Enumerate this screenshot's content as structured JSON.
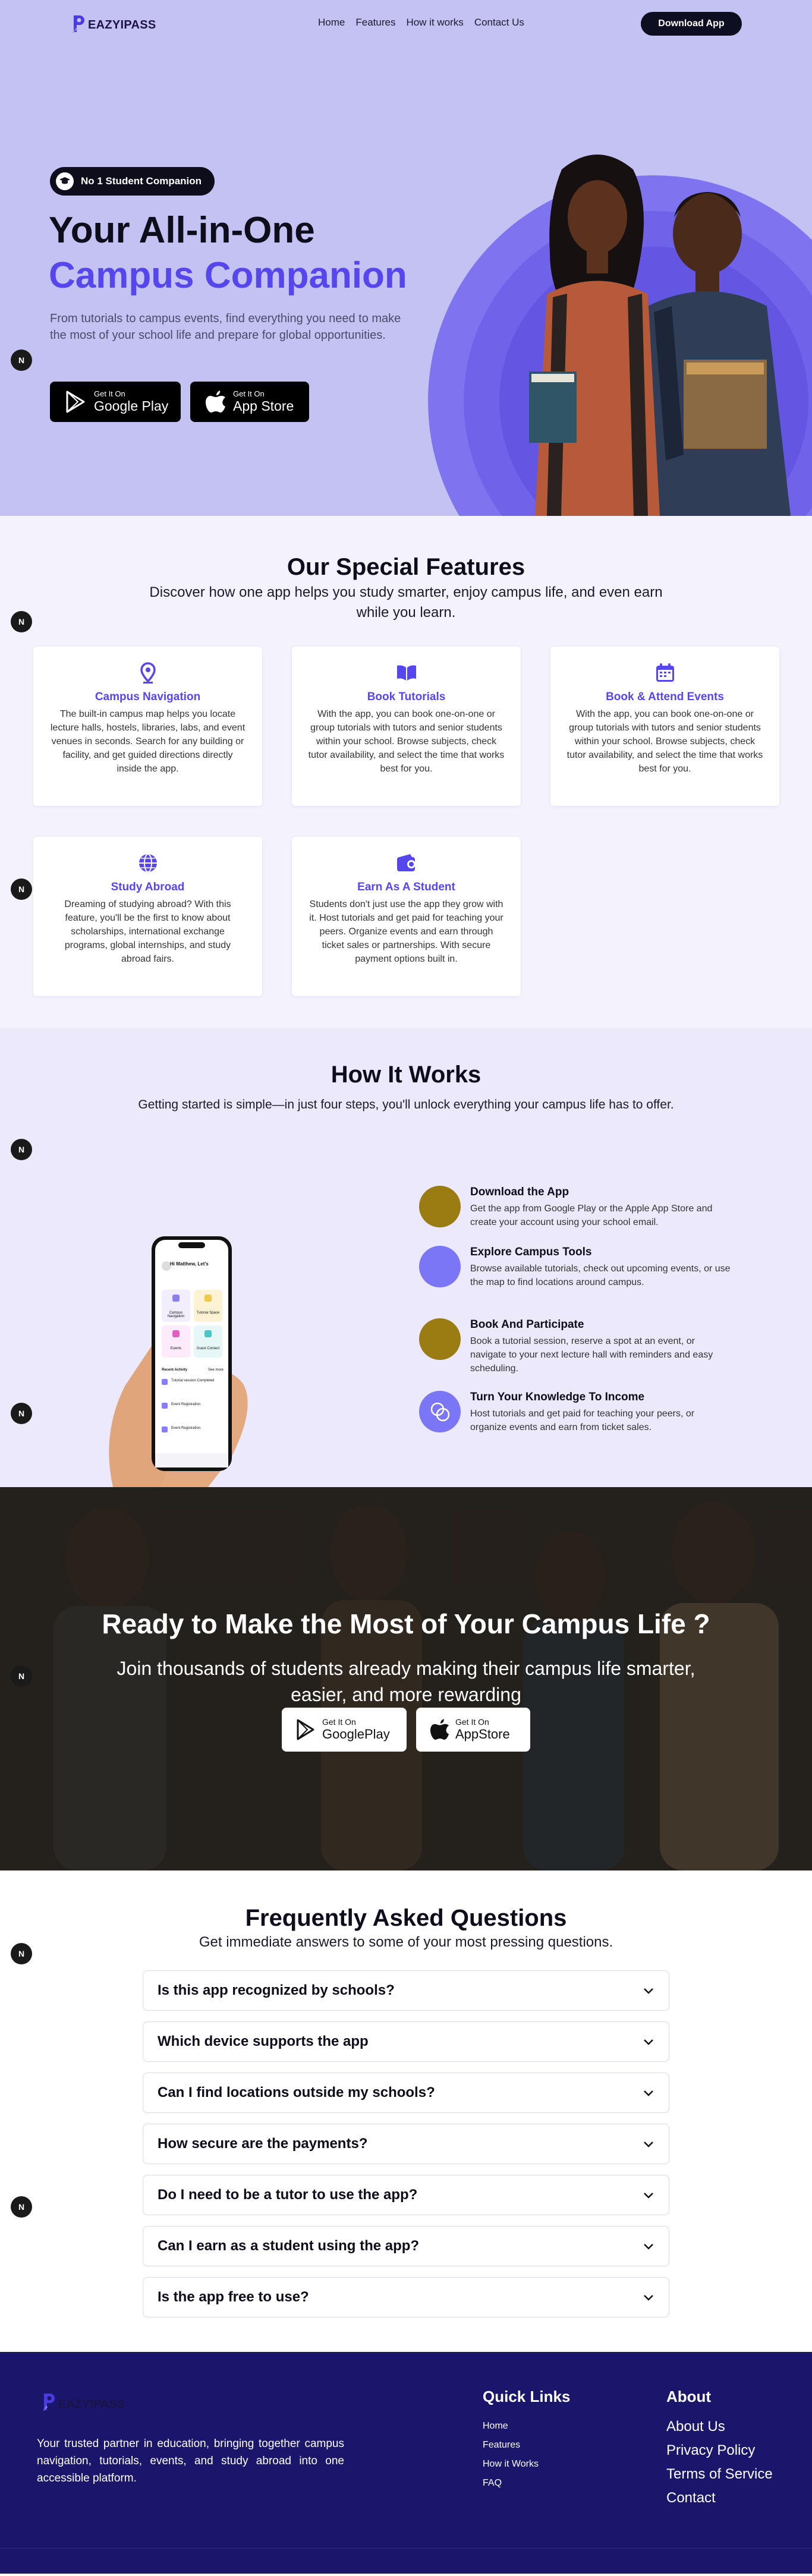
{
  "header": {
    "brand": "EAZYIPASS",
    "nav": [
      "Home",
      "Features",
      "How it works",
      "Contact Us"
    ],
    "download_label": "Download App"
  },
  "hero": {
    "badge": "No 1 Student Companion",
    "title_line1": "Your All-in-One",
    "title_line2": "Campus Companion",
    "subtitle": "From tutorials to campus events, find everything you need to make the most of your school life and prepare for global opportunities.",
    "google": {
      "small": "Get It On",
      "big": "Google Play"
    },
    "apple": {
      "small": "Get It On",
      "big": "App Store"
    }
  },
  "scroll_badge": "N",
  "features": {
    "title": "Our Special Features",
    "subtitle": "Discover how one app helps you study smarter, enjoy campus life, and even earn while you learn.",
    "cards": [
      {
        "icon": "map-pin-icon",
        "title": "Campus Navigation",
        "desc": "The built-in campus map helps you locate lecture halls, hostels, libraries, labs, and event venues in seconds. Search for any building or facility, and get guided directions directly inside the app."
      },
      {
        "icon": "book-icon",
        "title": "Book Tutorials",
        "desc": "With the app, you can book one-on-one or group tutorials with tutors and senior students within your school. Browse subjects, check tutor availability, and select the time that works best for you."
      },
      {
        "icon": "calendar-icon",
        "title": "Book & Attend Events",
        "desc": "With the app, you can book one-on-one or group tutorials with tutors and senior students within your school. Browse subjects, check tutor availability, and select the time that works best for you."
      },
      {
        "icon": "globe-icon",
        "title": "Study Abroad",
        "desc": "Dreaming of studying abroad? With this feature, you'll be the first to know about scholarships, international exchange programs, global internships, and study abroad fairs."
      },
      {
        "icon": "wallet-icon",
        "title": "Earn As A Student",
        "desc": "Students don't just use the app they grow with it. Host tutorials and get paid for teaching your peers. Organize events and earn through ticket sales or partnerships. With secure payment options built in."
      }
    ]
  },
  "how": {
    "title": "How It Works",
    "subtitle": "Getting started is simple—in just four steps, you'll unlock everything your campus life has to offer.",
    "steps": [
      {
        "title": "Download the App",
        "desc": "Get the app from Google Play or the Apple App Store and create your account using your school email.",
        "color": "#9a7c12"
      },
      {
        "title": "Explore Campus Tools",
        "desc": "Browse available tutorials, check out upcoming events, or use the map to find locations around campus.",
        "color": "#7b76f5"
      },
      {
        "title": "Book And Participate",
        "desc": "Book a tutorial session, reserve a spot at an event, or navigate to your next lecture hall with reminders and easy scheduling.",
        "color": "#9a7c12"
      },
      {
        "title": "Turn Your Knowledge To Income",
        "desc": "Host tutorials and get paid for teaching your peers, or organize events and earn from ticket sales.",
        "color": "#7b76f5"
      }
    ],
    "phone": {
      "greeting": "Hi Matthew, Let's",
      "tiles": [
        "Campus Navigation",
        "Tutorial Space",
        "Events",
        "Guest Contact"
      ],
      "recent_label": "Recent Activity",
      "see_all": "See more",
      "items": [
        "Tutorial session Completed",
        "Event Registration",
        "Event Registration"
      ]
    }
  },
  "cta": {
    "title": "Ready to Make the Most of Your Campus Life ?",
    "subtitle": "Join thousands of students already making their campus life smarter, easier, and more rewarding",
    "google": {
      "small": "Get It On",
      "big": "GooglePlay"
    },
    "apple": {
      "small": "Get It On",
      "big": "AppStore"
    }
  },
  "faq": {
    "title": "Frequently Asked Questions",
    "subtitle": "Get immediate answers to some of your most pressing questions.",
    "questions": [
      "Is this app recognized by schools?",
      "Which device supports the app",
      "Can I find locations outside my schools?",
      "How secure are the payments?",
      "Do I need to be a tutor to use the app?",
      "Can I earn as a student using the app?",
      "Is the app free to use?"
    ]
  },
  "footer": {
    "brand": "EAZYIPASS",
    "description": "Your trusted partner in education, bringing together campus navigation, tutorials, events, and study abroad into one accessible platform.",
    "quick_links_title": "Quick Links",
    "quick_links": [
      "Home",
      "Features",
      "How it Works",
      "FAQ"
    ],
    "about_title": "About",
    "about_links": [
      "About Us",
      "Privacy Policy",
      "Terms of Service",
      "Contact"
    ]
  },
  "colors": {
    "accent": "#5546ed",
    "hero_bg": "#c4c1f3",
    "footer_bg": "#19166c",
    "dark": "#0d0d1c"
  }
}
